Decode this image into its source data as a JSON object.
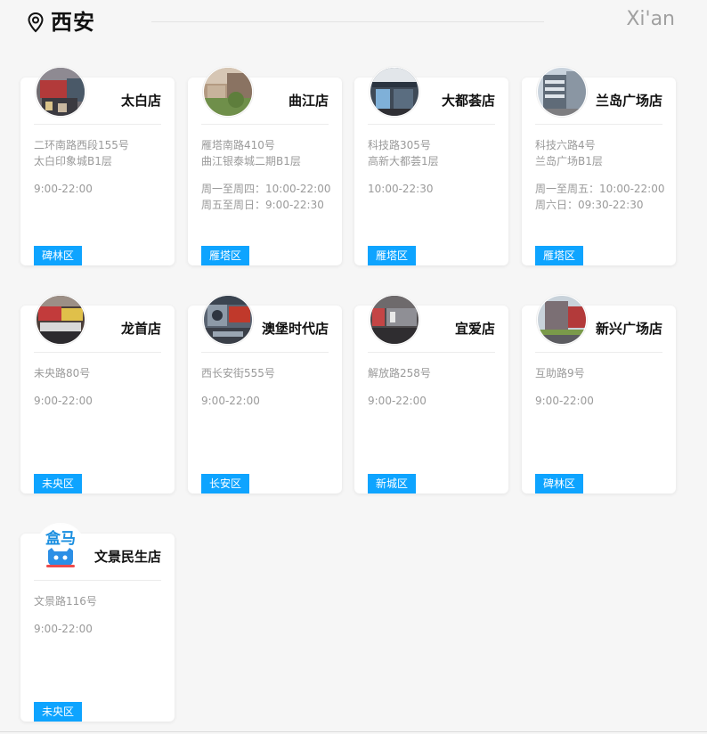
{
  "header": {
    "city": "西安",
    "city_en": "Xi'an",
    "icon": "location-pin-icon"
  },
  "stores": [
    {
      "name": "太白店",
      "address": [
        "二环南路西段155号",
        "太白印象城B1层"
      ],
      "hours": [
        "9:00-22:00"
      ],
      "district": "碑林区",
      "photo": "storefront-photo"
    },
    {
      "name": "曲江店",
      "address": [
        "雁塔南路410号",
        "曲江银泰城二期B1层"
      ],
      "hours": [
        "周一至周四：10:00-22:00",
        "周五至周日：9:00-22:30"
      ],
      "district": "雁塔区",
      "photo": "storefront-photo"
    },
    {
      "name": "大都荟店",
      "address": [
        "科技路305号",
        "高新大都荟1层"
      ],
      "hours": [
        "10:00-22:30"
      ],
      "district": "雁塔区",
      "photo": "storefront-photo"
    },
    {
      "name": "兰岛广场店",
      "address": [
        "科技六路4号",
        "兰岛广场B1层"
      ],
      "hours": [
        "周一至周五：10:00-22:00",
        "周六日：09:30-22:30"
      ],
      "district": "雁塔区",
      "photo": "storefront-photo"
    },
    {
      "name": "龙首店",
      "address": [
        "未央路80号"
      ],
      "hours": [
        "9:00-22:00"
      ],
      "district": "未央区",
      "photo": "storefront-photo"
    },
    {
      "name": "澳堡时代店",
      "address": [
        "西长安街555号"
      ],
      "hours": [
        "9:00-22:00"
      ],
      "district": "长安区",
      "photo": "storefront-photo"
    },
    {
      "name": "宜爱店",
      "address": [
        "解放路258号"
      ],
      "hours": [
        "9:00-22:00"
      ],
      "district": "新城区",
      "photo": "storefront-photo"
    },
    {
      "name": "新兴广场店",
      "address": [
        "互助路9号"
      ],
      "hours": [
        "9:00-22:00"
      ],
      "district": "碑林区",
      "photo": "storefront-photo"
    },
    {
      "name": "文景民生店",
      "address": [
        "文景路116号"
      ],
      "hours": [
        "9:00-22:00"
      ],
      "district": "未央区",
      "photo": "hema-logo",
      "logo_text": "盒马"
    }
  ],
  "colors": {
    "district_badge": "#0ea4ff",
    "secondary_text": "#9a9a9a",
    "page_background": "#f6f6f6"
  }
}
